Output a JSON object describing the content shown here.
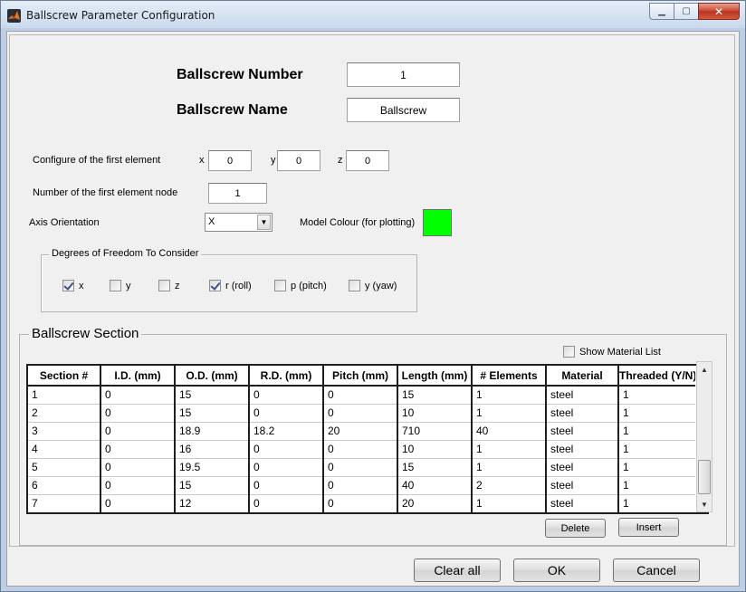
{
  "window": {
    "title": "Ballscrew Parameter Configuration",
    "controls": {
      "minimize": "▁",
      "maximize": "▢",
      "close": "✕"
    }
  },
  "header": {
    "number_label": "Ballscrew Number",
    "number_value": "1",
    "name_label": "Ballscrew Name",
    "name_value": "Ballscrew"
  },
  "first_element": {
    "label": "Configure of the first element",
    "x_label": "x",
    "x_value": "0",
    "y_label": "y",
    "y_value": "0",
    "z_label": "z",
    "z_value": "0",
    "node_label": "Number of the first element node",
    "node_value": "1"
  },
  "axis": {
    "label": "Axis Orientation",
    "selected": "X",
    "arrow": "▼"
  },
  "model_colour": {
    "label": "Model Colour (for plotting)",
    "color": "#00ff00"
  },
  "dof": {
    "title": "Degrees of Freedom To Consider",
    "items": [
      {
        "label": "x",
        "checked": true
      },
      {
        "label": "y",
        "checked": false
      },
      {
        "label": "z",
        "checked": false
      },
      {
        "label": "r (roll)",
        "checked": true
      },
      {
        "label": "p  (pitch)",
        "checked": false
      },
      {
        "label": "y (yaw)",
        "checked": false
      }
    ]
  },
  "section": {
    "title": "Ballscrew Section",
    "show_material_label": "Show Material List",
    "columns": [
      "Section #",
      "I.D. (mm)",
      "O.D. (mm)",
      "R.D. (mm)",
      "Pitch (mm)",
      "Length (mm)",
      "# Elements",
      "Material",
      "Threaded (Y/N)"
    ],
    "rows": [
      [
        "1",
        "0",
        "15",
        "0",
        "0",
        "15",
        "1",
        "steel",
        "1"
      ],
      [
        "2",
        "0",
        "15",
        "0",
        "0",
        "10",
        "1",
        "steel",
        "1"
      ],
      [
        "3",
        "0",
        "18.9",
        "18.2",
        "20",
        "710",
        "40",
        "steel",
        "1"
      ],
      [
        "4",
        "0",
        "16",
        "0",
        "0",
        "10",
        "1",
        "steel",
        "1"
      ],
      [
        "5",
        "0",
        "19.5",
        "0",
        "0",
        "15",
        "1",
        "steel",
        "1"
      ],
      [
        "6",
        "0",
        "15",
        "0",
        "0",
        "40",
        "2",
        "steel",
        "1"
      ],
      [
        "7",
        "0",
        "12",
        "0",
        "0",
        "20",
        "1",
        "steel",
        "1"
      ]
    ],
    "scroll_up": "▲",
    "scroll_down": "▼",
    "delete_label": "Delete",
    "insert_label": "Insert"
  },
  "footer": {
    "clear_label": "Clear all",
    "ok_label": "OK",
    "cancel_label": "Cancel"
  }
}
